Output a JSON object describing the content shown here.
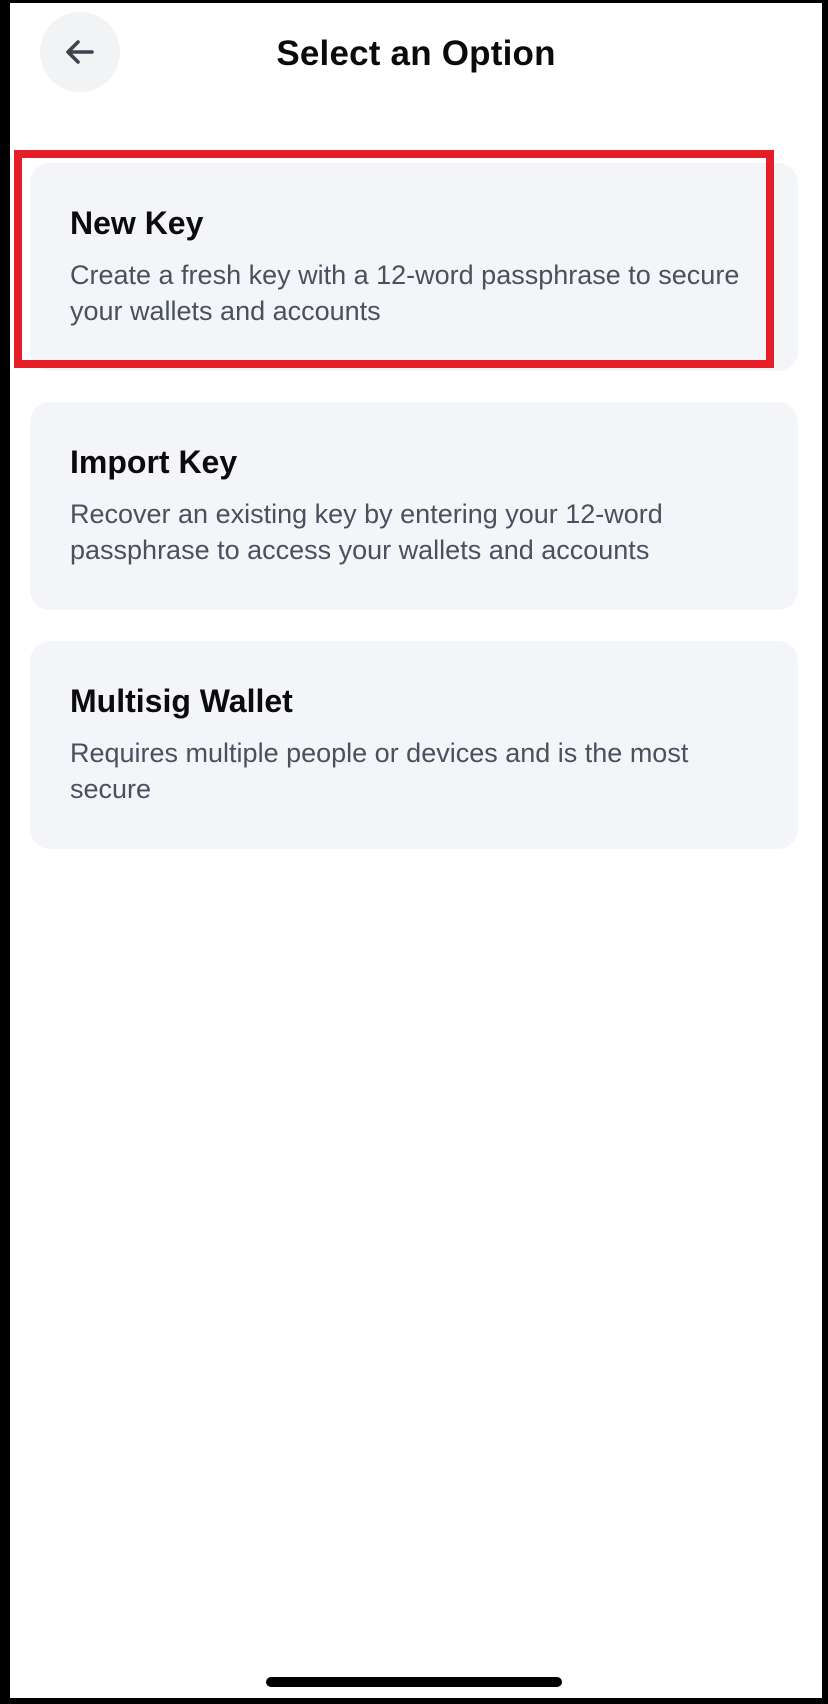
{
  "header": {
    "title": "Select an Option",
    "back_icon": "arrow-left-icon"
  },
  "options": [
    {
      "title": "New Key",
      "description": "Create a fresh key with a 12-word passphrase to secure your wallets and accounts"
    },
    {
      "title": "Import Key",
      "description": "Recover an existing key by entering your 12-word passphrase to access your wallets and accounts"
    },
    {
      "title": "Multisig Wallet",
      "description": "Requires multiple people or devices and is the most secure"
    }
  ],
  "colors": {
    "highlight": "#e51e28",
    "card_background": "#f4f5f9",
    "back_button_background": "#f2f3f5"
  }
}
